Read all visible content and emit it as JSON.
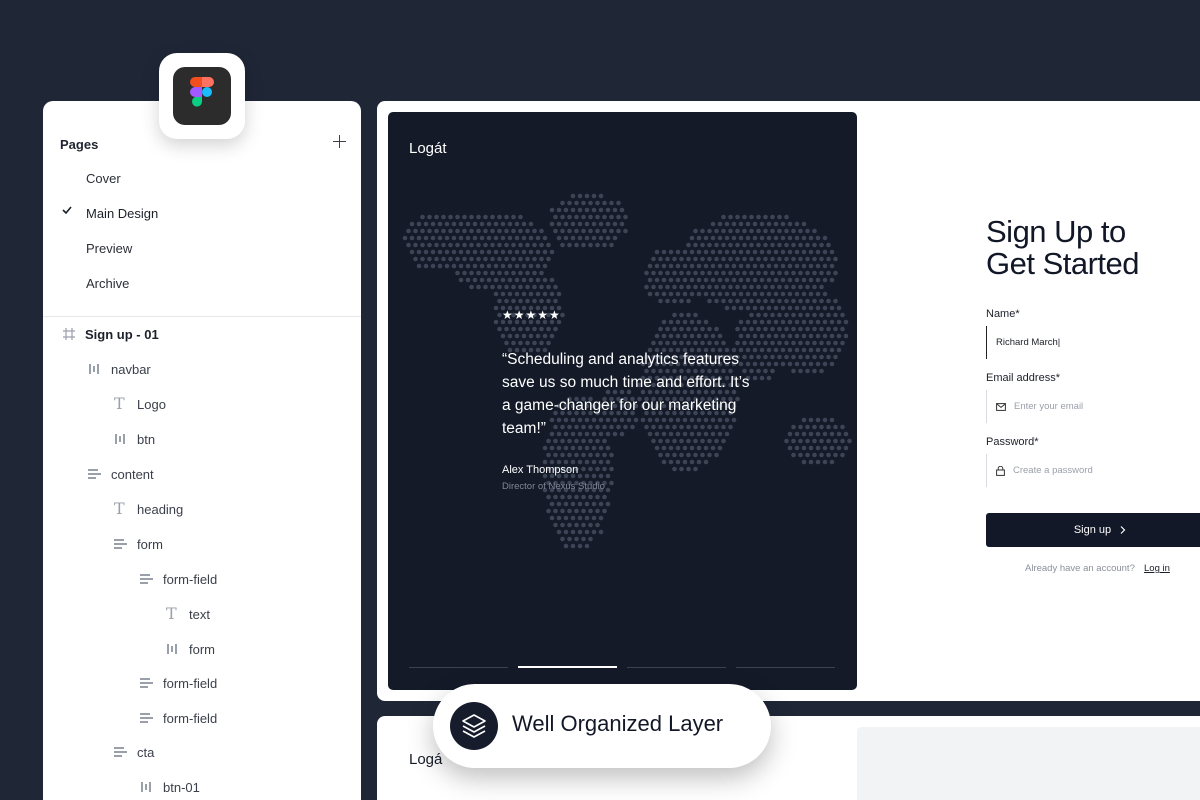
{
  "layers_panel": {
    "pages_title": "Pages",
    "pages": [
      {
        "label": "Cover"
      },
      {
        "label": "Main Design"
      },
      {
        "label": "Preview"
      },
      {
        "label": "Archive"
      }
    ],
    "layers": [
      {
        "label": "Sign up - 01",
        "icon": "frame-icon"
      },
      {
        "label": "navbar",
        "icon": "auto-layout-horizontal-icon"
      },
      {
        "label": "Logo",
        "icon": "text-icon"
      },
      {
        "label": "btn",
        "icon": "auto-layout-horizontal-icon"
      },
      {
        "label": "content",
        "icon": "auto-layout-vertical-icon"
      },
      {
        "label": "heading",
        "icon": "text-icon"
      },
      {
        "label": "form",
        "icon": "auto-layout-vertical-icon"
      },
      {
        "label": "form-field",
        "icon": "auto-layout-vertical-icon"
      },
      {
        "label": "text",
        "icon": "text-icon"
      },
      {
        "label": "form",
        "icon": "auto-layout-horizontal-icon"
      },
      {
        "label": "form-field",
        "icon": "auto-layout-vertical-icon"
      },
      {
        "label": "form-field",
        "icon": "auto-layout-vertical-icon"
      },
      {
        "label": "cta",
        "icon": "auto-layout-vertical-icon"
      },
      {
        "label": "btn-01",
        "icon": "auto-layout-horizontal-icon"
      }
    ]
  },
  "figma_badge": {
    "icon": "figma-logo-icon"
  },
  "design": {
    "card_logo": "Logát",
    "rating": "★★★★★",
    "quote": "“Scheduling and analytics features save us so much time and effort. It’s a game-changer for our marketing team!”",
    "author": "Alex Thompson",
    "author_role": "Director of Nexus Studio",
    "heading_line1": "Sign Up to",
    "heading_line2": "Get Started",
    "name_label": "Name*",
    "name_value": "Richard March|",
    "email_label": "Email address*",
    "email_placeholder": "Enter your email",
    "password_label": "Password*",
    "password_placeholder": "Create a password",
    "signup_button": "Sign up",
    "already_text": "Already have an account?",
    "login_link": "Log in"
  },
  "frame_2": {
    "logo": "Logá"
  },
  "pill": {
    "label": "Well Organized Layer",
    "icon": "layers-icon"
  },
  "colors": {
    "background": "#1f2636",
    "card_dark": "#141a28",
    "button_dark": "#121827",
    "map_dots": "#3c4455"
  }
}
